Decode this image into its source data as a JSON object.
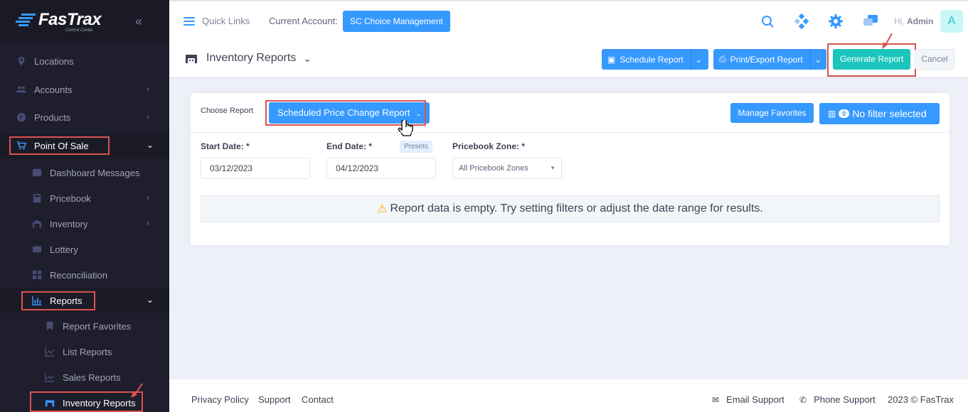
{
  "brand": {
    "name": "FasTrax",
    "tagline": "Control Center"
  },
  "sidebar": {
    "items": [
      {
        "label": "Locations"
      },
      {
        "label": "Accounts"
      },
      {
        "label": "Products"
      },
      {
        "label": "Point Of Sale"
      },
      {
        "label": "Dashboard Messages"
      },
      {
        "label": "Pricebook"
      },
      {
        "label": "Inventory"
      },
      {
        "label": "Lottery"
      },
      {
        "label": "Reconciliation"
      },
      {
        "label": "Reports"
      },
      {
        "label": "Report Favorites"
      },
      {
        "label": "List Reports"
      },
      {
        "label": "Sales Reports"
      },
      {
        "label": "Inventory Reports"
      }
    ]
  },
  "topbar": {
    "quick_links": "Quick Links",
    "current_account_label": "Current Account:",
    "current_account": "SC Choice Management",
    "greeting": "Hi,",
    "user": "Admin",
    "avatar_initial": "A"
  },
  "subheader": {
    "title": "Inventory Reports",
    "schedule": "Schedule Report",
    "print_export": "Print/Export Report",
    "generate": "Generate Report",
    "cancel": "Cancel"
  },
  "report": {
    "choose_label": "Choose Report",
    "selected": "Scheduled Price Change Report",
    "manage_favorites": "Manage Favorites",
    "filter_count": "0",
    "filter_text": "No filter selected",
    "start_label": "Start Date: *",
    "start_value": "03/12/2023",
    "end_label": "End Date: *",
    "end_value": "04/12/2023",
    "presets": "Presets",
    "zone_label": "Pricebook Zone: *",
    "zone_value": "All Pricebook Zones",
    "empty_message": "Report data is empty. Try setting filters or adjust the date range for results."
  },
  "footer": {
    "privacy": "Privacy Policy",
    "support": "Support",
    "contact": "Contact",
    "email_support": "Email Support",
    "phone_support": "Phone Support",
    "copyright": "2023 © FasTrax"
  },
  "colors": {
    "primary": "#3699ff",
    "success": "#1bc5bd",
    "sidebar": "#1e1e2d",
    "highlight": "#d9534f"
  }
}
